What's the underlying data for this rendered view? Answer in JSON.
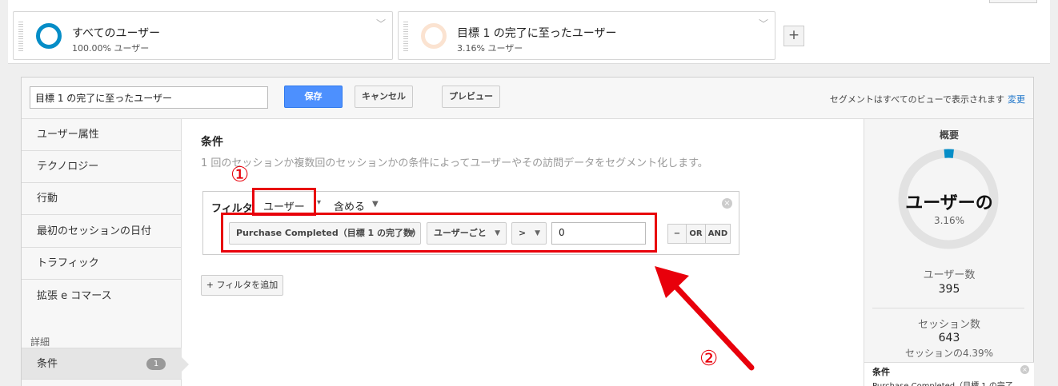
{
  "segments": [
    {
      "name": "すべてのユーザー",
      "pct": "100.00% ユーザー",
      "color": "#058dc7"
    },
    {
      "name": "目標 1 の完了に至ったユーザー",
      "pct": "3.16% ユーザー",
      "color": "#f8d7bd"
    }
  ],
  "add_segment": "+",
  "header": {
    "segment_name": "目標 1 の完了に至ったユーザー",
    "save": "保存",
    "cancel": "キャンセル",
    "preview": "プレビュー",
    "note": "セグメントはすべてのビューで表示されます",
    "change": "変更"
  },
  "sidebar": {
    "items": [
      "ユーザー属性",
      "テクノロジー",
      "行動",
      "最初のセッションの日付",
      "トラフィック",
      "拡張 e コマース"
    ],
    "section_label": "詳細",
    "active_item": "条件",
    "active_badge": "1"
  },
  "main": {
    "title": "条件",
    "description": "1 回のセッションか複数回のセッションかの条件によってユーザーやその訪問データをセグメント化します。",
    "filter_label": "フィルタ",
    "filter_type": "ユーザー",
    "filter_include": "含める",
    "metric": "Purchase Completed（目標 1 の完了数）",
    "scope": "ユーザーごと",
    "operator": ">",
    "value": "0",
    "btn_minus": "−",
    "btn_or": "OR",
    "btn_and": "AND",
    "add_filter": "+ フィルタを追加"
  },
  "summary": {
    "title": "概要",
    "donut_label": "ユーザーの",
    "donut_pct": "3.16%",
    "donut_fraction": 0.0316,
    "users_label": "ユーザー数",
    "users_value": "395",
    "sessions_label": "セッション数",
    "sessions_value": "643",
    "sessions_pct": "セッションの4.39%",
    "cond_title": "条件",
    "cond_text": "Purchase Completed（目標 1 の完了"
  },
  "annotations": {
    "one": "①",
    "two": "②",
    "color": "#e8000b"
  }
}
